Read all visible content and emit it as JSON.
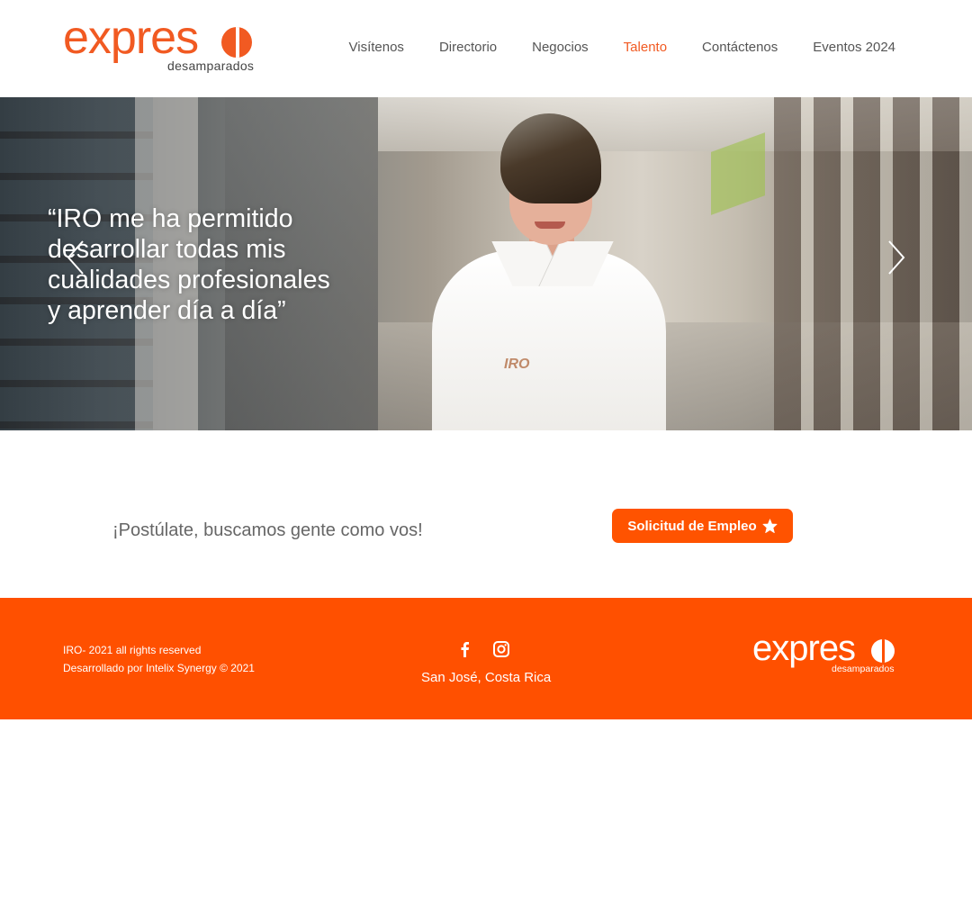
{
  "brand": {
    "logo_word": "expres",
    "logo_sub": "desamparados",
    "accent_color": "#f15a22",
    "footer_color": "#ff5000"
  },
  "nav": {
    "items": [
      {
        "label": "Visítenos"
      },
      {
        "label": "Directorio"
      },
      {
        "label": "Negocios"
      },
      {
        "label": "Talento"
      },
      {
        "label": "Contáctenos"
      },
      {
        "label": "Eventos 2024"
      }
    ],
    "active": "Talento"
  },
  "hero": {
    "quote_lines": [
      "“IRO me ha permitido",
      "desarrollar todas mis",
      "cualidades profesionales",
      "y aprender día a día”"
    ],
    "shirt_logo": "IRO",
    "prev_icon": "chevron-left-icon",
    "next_icon": "chevron-right-icon"
  },
  "cta": {
    "text": "¡Postúlate, buscamos gente como vos!",
    "button_label": "Solicitud de Empleo",
    "button_icon": "star-icon"
  },
  "footer": {
    "rights": "IRO- 2021 all rights reserved",
    "developer": "Desarrollado por Intelix Synergy © 2021",
    "social": [
      "facebook-icon",
      "instagram-icon"
    ],
    "location": "San José, Costa Rica",
    "logo_word": "expres",
    "logo_sub": "desamparados"
  }
}
